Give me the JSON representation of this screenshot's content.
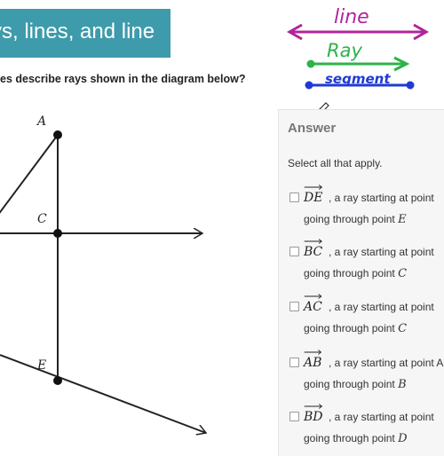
{
  "header": {
    "title": "ys, lines, and line"
  },
  "question": {
    "text": "es describe rays shown in the diagram below?"
  },
  "diagram": {
    "point_labels": {
      "A": "A",
      "C": "C",
      "E": "E"
    }
  },
  "annotation": {
    "line_word": "line",
    "ray_word": "Ray",
    "segment_word": "segment",
    "colors": {
      "line": "#b0259b",
      "ray": "#2db34a",
      "segment": "#1e3ad6"
    }
  },
  "answer": {
    "heading": "Answer",
    "instruction": "Select all that apply.",
    "options": [
      {
        "ray": "DE",
        "line1": ", a ray starting at point",
        "line2_prefix": "going through point",
        "line2_point": "E"
      },
      {
        "ray": "BC",
        "line1": ", a ray starting at point",
        "line2_prefix": "going through point",
        "line2_point": "C"
      },
      {
        "ray": "AC",
        "line1": ", a ray starting at point",
        "line2_prefix": "going through point",
        "line2_point": "C"
      },
      {
        "ray": "AB",
        "line1": ", a ray starting at point A",
        "line2_prefix": "going through point",
        "line2_point": "B"
      },
      {
        "ray": "BD",
        "line1": ", a ray starting at point",
        "line2_prefix": "going through point",
        "line2_point": "D"
      }
    ]
  },
  "colors": {
    "banner": "#3e9bab",
    "panel": "#f6f6f6"
  },
  "icons": {
    "cursor": "pencil-cursor-icon"
  }
}
